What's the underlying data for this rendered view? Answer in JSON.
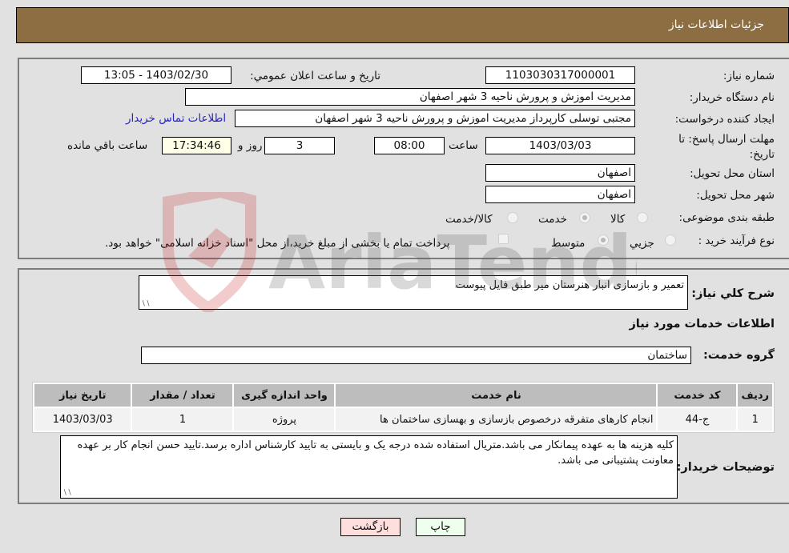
{
  "header": {
    "title": "جزئیات اطلاعات نیاز"
  },
  "form": {
    "need_number": {
      "label": "شماره نیاز:",
      "value": "1103030317000001"
    },
    "announce_datetime": {
      "label": "تاریخ و ساعت اعلان عمومي:",
      "value": "1403/02/30 - 13:05"
    },
    "buyer_org": {
      "label": "نام دستگاه خریدار:",
      "value": "مدیریت اموزش و پرورش ناحیه 3 شهر اصفهان"
    },
    "requester": {
      "label": "ایجاد کننده درخواست:",
      "value": "مجتبی توسلی کارپرداز مدیریت اموزش و پرورش ناحیه 3 شهر اصفهان",
      "contact_link": "اطلاعات تماس خریدار"
    },
    "deadline": {
      "label": "مهلت ارسال پاسخ: تا تاریخ:",
      "date": "1403/03/03",
      "time_label": "ساعت",
      "time": "08:00",
      "days": "3",
      "days_label": "روز و",
      "remaining": "17:34:46",
      "remaining_label": "ساعت باقي مانده"
    },
    "province": {
      "label": "استان محل تحویل:",
      "value": "اصفهان"
    },
    "city": {
      "label": "شهر محل تحویل:",
      "value": "اصفهان"
    },
    "category": {
      "label": "طبقه بندی موضوعی:",
      "options": [
        "کالا",
        "خدمت",
        "کالا/خدمت"
      ],
      "selected": "خدمت"
    },
    "purchase_type": {
      "label": "نوع فرآیند خرید :",
      "options": [
        "جزیي",
        "متوسط"
      ],
      "selected": "متوسط",
      "treasury_note": "پرداخت تمام یا بخشی از مبلغ خرید،از محل \"اسناد خزانه اسلامی\" خواهد بود."
    }
  },
  "details": {
    "summary_label": "شرح کلي نياز:",
    "summary_value": "تعمیر و بازسازی انبار هنرستان میر طبق فایل پیوست",
    "services_heading": "اطلاعات خدمات مورد نیاز",
    "service_group_label": "گروه خدمت:",
    "service_group_value": "ساختمان",
    "table": {
      "headers": [
        "ردیف",
        "کد خدمت",
        "نام خدمت",
        "واحد اندازه گیری",
        "تعداد / مقدار",
        "تاریخ نیاز"
      ],
      "rows": [
        [
          "1",
          "ج-44",
          "انجام کارهای متفرقه درخصوص بازسازی و بهسازی ساختمان ها",
          "پروژه",
          "1",
          "1403/03/03"
        ]
      ]
    },
    "buyer_notes_label": "توضیحات خریدار:",
    "buyer_notes_value": "کلیه هزینه ها به عهده پیمانکار می باشد.متریال استفاده شده درجه یک و بایستی به تایید کارشناس اداره برسد.تایید حسن انجام کار بر عهده معاونت پشتیبانی می باشد."
  },
  "buttons": {
    "print": "چاپ",
    "back": "بازگشت"
  },
  "watermark": {
    "text": "AriaTender.neT"
  }
}
